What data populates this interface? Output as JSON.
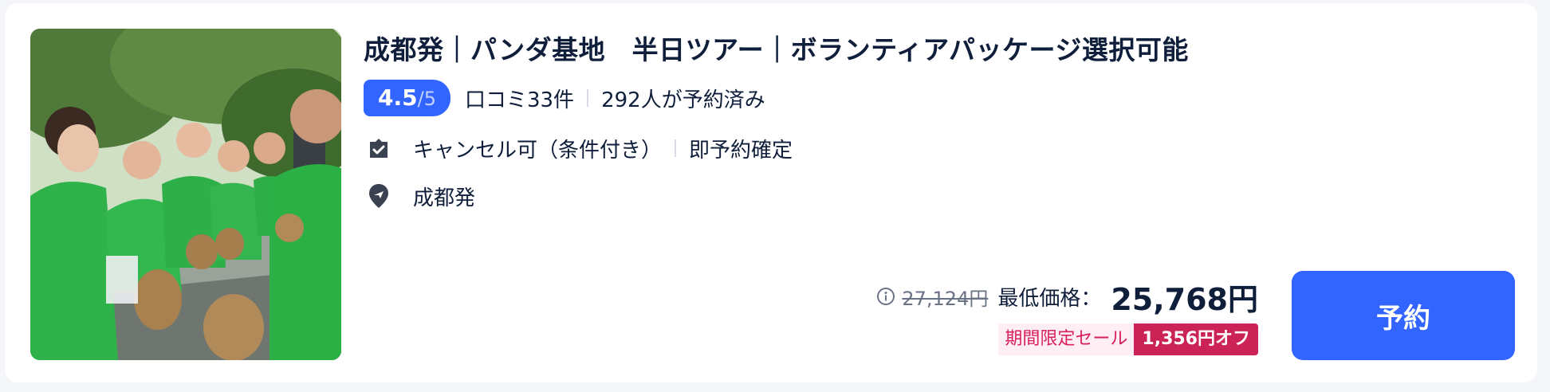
{
  "product": {
    "title": "成都発｜パンダ基地　半日ツアー｜ボランティアパッケージ選択可能",
    "rating": {
      "score": "4.5",
      "max": "/5",
      "reviews": "口コミ33件",
      "booked": "292人が予約済み"
    },
    "features": {
      "cancel": "キャンセル可（条件付き）",
      "instant": "即予約確定",
      "cancel_icon": "ticket-check-icon"
    },
    "location": {
      "text": "成都発",
      "icon": "location-pin-icon"
    },
    "price": {
      "original": "27,124円",
      "min_label": "最低価格：",
      "current": "25,768円",
      "sale_label": "期間限定セール",
      "sale_off": "1,356円オフ"
    },
    "book_button": "予約"
  },
  "colors": {
    "accent": "#3264ff",
    "sale": "#cc2356",
    "sale_bg": "#ffeef4",
    "text": "#0f1e3a"
  }
}
